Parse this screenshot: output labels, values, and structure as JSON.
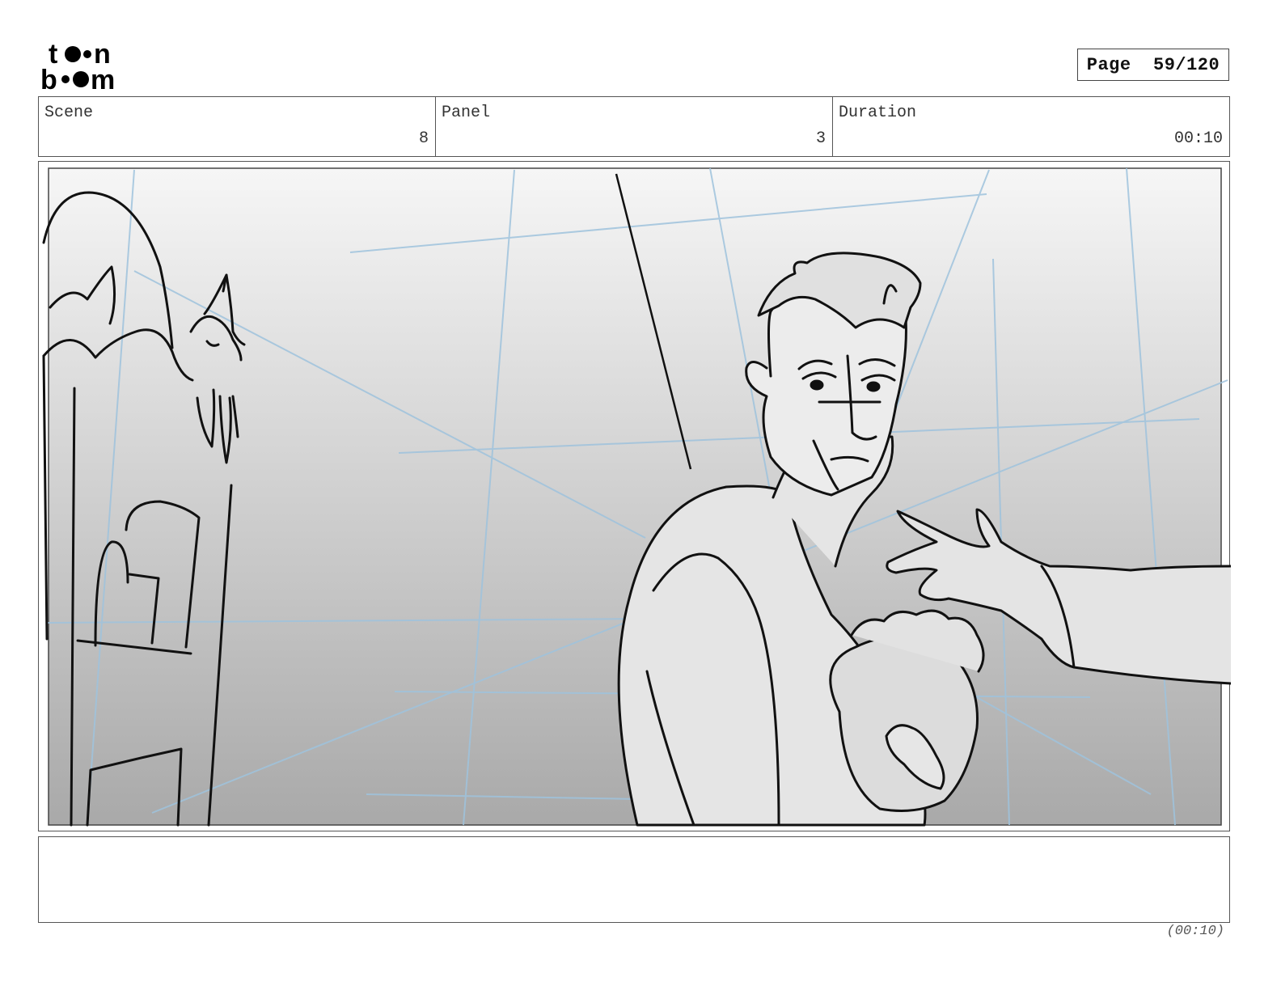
{
  "logo": {
    "name": "toon boom",
    "icon": "toon-boom-logo"
  },
  "page": {
    "label": "Page",
    "current": "59",
    "total": "120",
    "display": "59/120"
  },
  "header": {
    "scene": {
      "label": "Scene",
      "value": "8"
    },
    "panel": {
      "label": "Panel",
      "value": "3"
    },
    "duration": {
      "label": "Duration",
      "value": "00:10"
    }
  },
  "panel_image": {
    "icon": "storyboard-sketch"
  },
  "notes": {
    "text": ""
  },
  "footer": {
    "duration": "(00:10)"
  }
}
